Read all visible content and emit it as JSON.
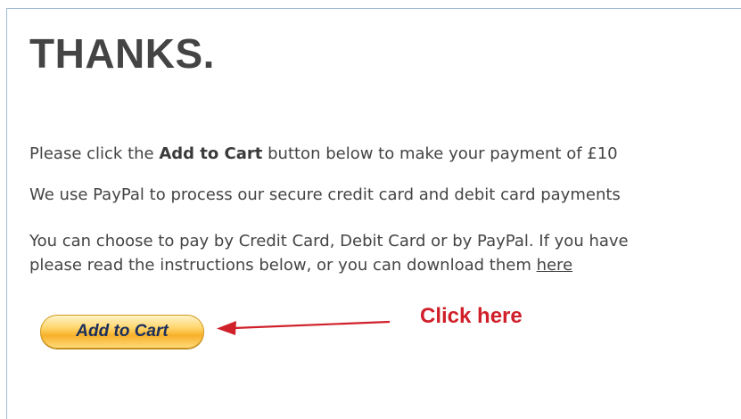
{
  "content": {
    "title": "THANKS.",
    "line1": {
      "before": "Please click the ",
      "bold": "Add to Cart",
      "after": " button below to make your payment of £10"
    },
    "line2": "We use PayPal to process our secure credit card and debit card payments",
    "line3": {
      "first": "You can choose to pay by Credit Card, Debit Card or by PayPal.  If you have",
      "second_before": "please read the instructions below, or you can download them ",
      "link": "here"
    }
  },
  "cart_button": {
    "label": "Add to Cart"
  },
  "annotation": {
    "label": "Click here",
    "color": "#d0202a"
  }
}
